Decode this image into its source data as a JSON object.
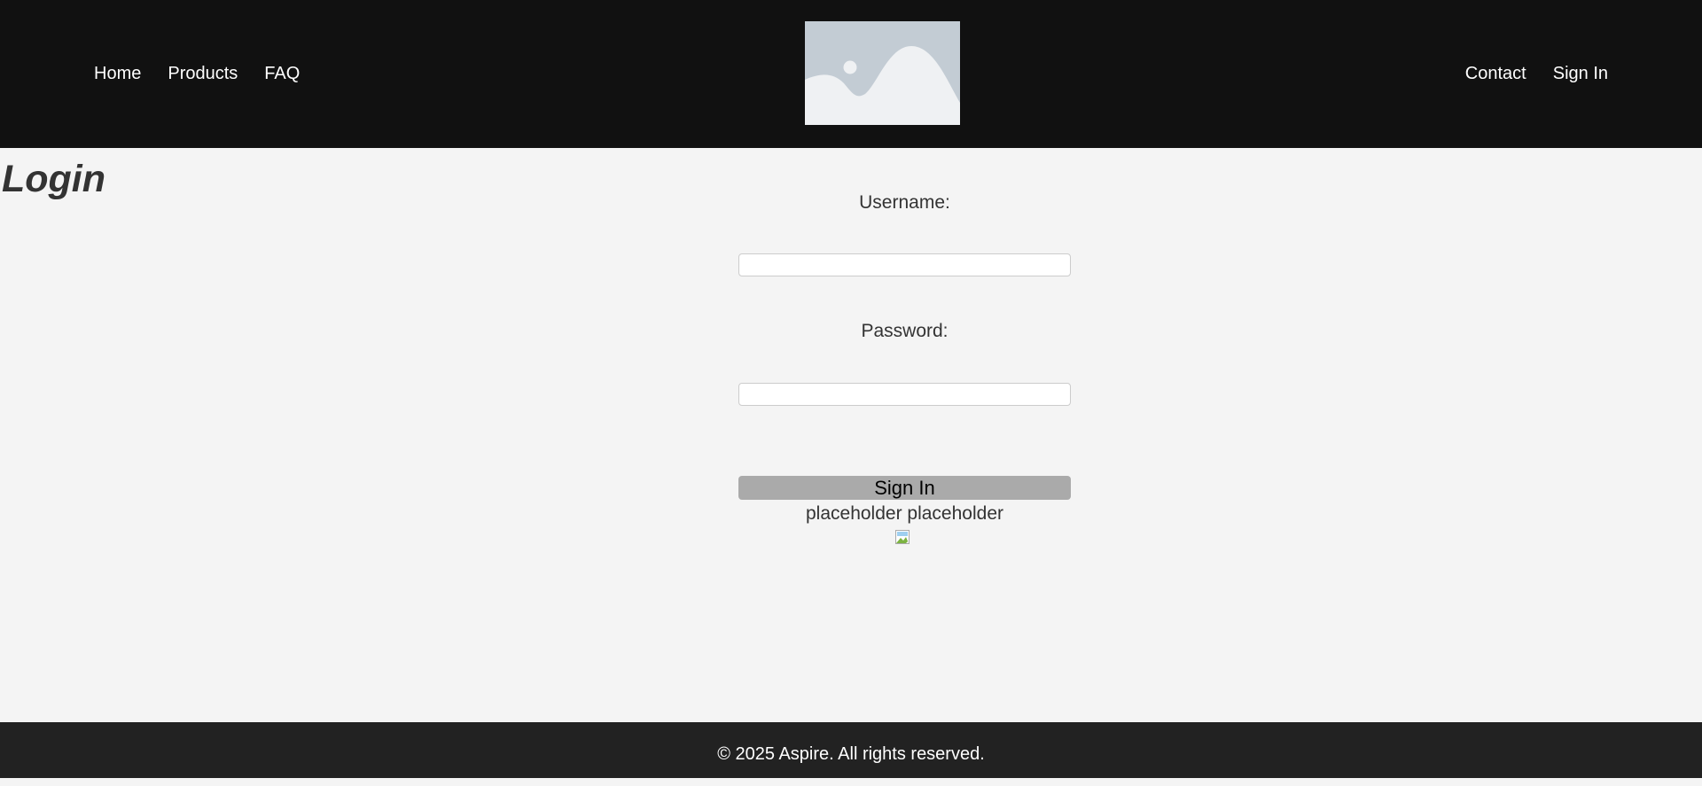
{
  "header": {
    "nav_left": [
      "Home",
      "Products",
      "FAQ"
    ],
    "nav_right": [
      "Contact",
      "Sign In"
    ],
    "logo_icon": "image-placeholder-icon"
  },
  "main": {
    "title": "Login",
    "form": {
      "username_label": "Username:",
      "username_value": "",
      "password_label": "Password:",
      "password_value": "",
      "submit_label": "Sign In",
      "helper_text": "placeholder placeholder",
      "image_icon": "broken-image-icon"
    }
  },
  "footer": {
    "copyright": "© 2025 Aspire. All rights reserved."
  },
  "colors": {
    "header_bg": "#111111",
    "page_bg": "#f4f4f4",
    "footer_bg": "#222222",
    "button_bg": "#aaaaaa",
    "text": "#333333"
  }
}
